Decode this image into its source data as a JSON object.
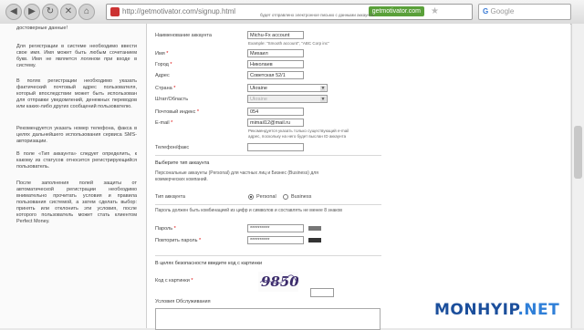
{
  "browser": {
    "url": "http://getmotivator.com/signup.html",
    "site_badge": "getmotivator.com",
    "search_placeholder": "Google"
  },
  "left_pane": {
    "paragraphs": [
      "достоверные данные!",
      "Для регистрации в системе необходимо ввести свое имя. Имя может быть любым сочетанием букв. Имя не является логином при входе в систему.",
      "В полях регистрации необходимо указать фактический почтовый адрес пользователя, который впоследствии может быть использован для отправки уведомлений, денежных переводов или каких-либо других сообщений пользователю.",
      "Рекомендуется указать номер телефона, факса в целях дальнейшего использования сервиса SMS-авторизации.",
      "В поле «Тип аккаунта» следует определить, к какому из статусов относится регистрирующийся пользователь.",
      "После заполнения полей защиты от автоматической регистрации необходимо внимательно прочитать условия и правила пользования системой, а затем сделать выбор: принять или отклонить эти условия, после которого пользователь может стать клиентом Perfect Money."
    ]
  },
  "form": {
    "top_note": "будет отправлено электронное письмо с данными аккаунта.",
    "account_name_label": "Наименование аккаунта",
    "account_name_value": "Michu-Fx account",
    "account_name_hint": "Example: \"Smooth account\", \"ABC Corp inc\"",
    "first_name_label": "Имя",
    "first_name_value": "Михаил",
    "city_label": "Город",
    "city_value": "Николаев",
    "address_label": "Адрес",
    "address_value": "Советская 52/1",
    "country_label": "Страна",
    "country_value": "Ukraine",
    "state_label": "Штат/Область",
    "state_value": "Ukraine",
    "zip_label": "Почтовый индекс",
    "zip_value": "054",
    "email_label": "E-mail",
    "email_value": "mimail12@mail.ru",
    "email_hint_1": "Рекомендуется указать только существующий e-mail",
    "email_hint_2": "адрес, поскольку на него будет выслан ID аккаунта",
    "phone_label": "Телефон/факс",
    "phone_value": "",
    "account_type_heading": "Выберите тип аккаунта",
    "account_type_desc_1": "Персональные аккаунты (Personal) для частных лиц и Бизнес (Business) для",
    "account_type_desc_2": "коммерческих компаний.",
    "account_type_label": "Тип аккаунта",
    "account_type_options": [
      "Personal",
      "Business"
    ],
    "account_type_selected": "Personal",
    "password_note": "Пароль должен быть комбинацией из цифр и символов и составлять не менее 8 знаков",
    "password_label": "Пароль",
    "password_value": "**********",
    "password_repeat_label": "Повторить пароль",
    "password_repeat_value": "**********",
    "captcha_note": "В целях безопасности введите код с картинки",
    "captcha_label": "Код с картинки",
    "captcha_text": "9850",
    "captcha_value": "",
    "terms_label": "Условия Обслуживания"
  },
  "watermark": {
    "prefix": "MONHYIP",
    "suffix": ".NET"
  },
  "colors": {
    "link_green": "#5aa03a",
    "required_red": "#dd0000",
    "logo_blue": "#1c4f9c"
  }
}
